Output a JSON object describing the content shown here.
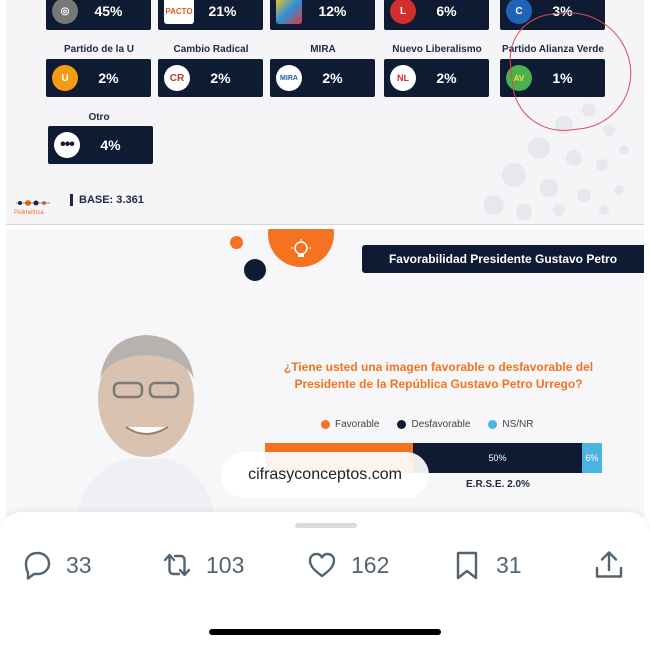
{
  "slide1": {
    "top_row": [
      {
        "pct": "45%",
        "logo": "circle-logo"
      },
      {
        "pct": "21%",
        "logo": "pacto-logo"
      },
      {
        "pct": "12%",
        "logo": "colorful-logo"
      },
      {
        "pct": "6%",
        "logo": "liberal-logo"
      },
      {
        "pct": "3%",
        "logo": "conservador-logo"
      }
    ],
    "parties": [
      {
        "name": "Partido de la U",
        "pct": "2%",
        "logo_text": "U",
        "color": "#f39c12"
      },
      {
        "name": "Cambio Radical",
        "pct": "2%",
        "logo_text": "CR",
        "color": "#c0392b"
      },
      {
        "name": "MIRA",
        "pct": "2%",
        "logo_text": "MIRA",
        "color": "#1f63b6"
      },
      {
        "name": "Nuevo Liberalismo",
        "pct": "2%",
        "logo_text": "NL",
        "color": "#d32f2f"
      },
      {
        "name": "Partido Alianza Verde",
        "pct": "1%",
        "logo_text": "AV",
        "color": "#4caf50"
      }
    ],
    "other": {
      "name": "Otro",
      "pct": "4%"
    },
    "base": "BASE: 3.361",
    "brand": "Polimétrica"
  },
  "slide2": {
    "title": "Favorabilidad Presidente Gustavo Petro",
    "question": "¿Tiene usted una imagen favorable o desfavorable del Presidente de la República Gustavo Petro Urrego?",
    "legend": [
      {
        "label": "Favorable",
        "color": "#f37321"
      },
      {
        "label": "Desfavorable",
        "color": "#0f1a33"
      },
      {
        "label": "NS/NR",
        "color": "#4ab5e3"
      }
    ],
    "bar": {
      "favorable": 44,
      "desfavorable": 50,
      "nsnr": 6,
      "desfavorable_label": "50%",
      "nsnr_label": "6%"
    },
    "erse": "E.R.S.E. 2.0%",
    "watermark": "cifrasyconceptos.com"
  },
  "actions": {
    "replies": "33",
    "reposts": "103",
    "likes": "162",
    "bookmarks": "31"
  }
}
